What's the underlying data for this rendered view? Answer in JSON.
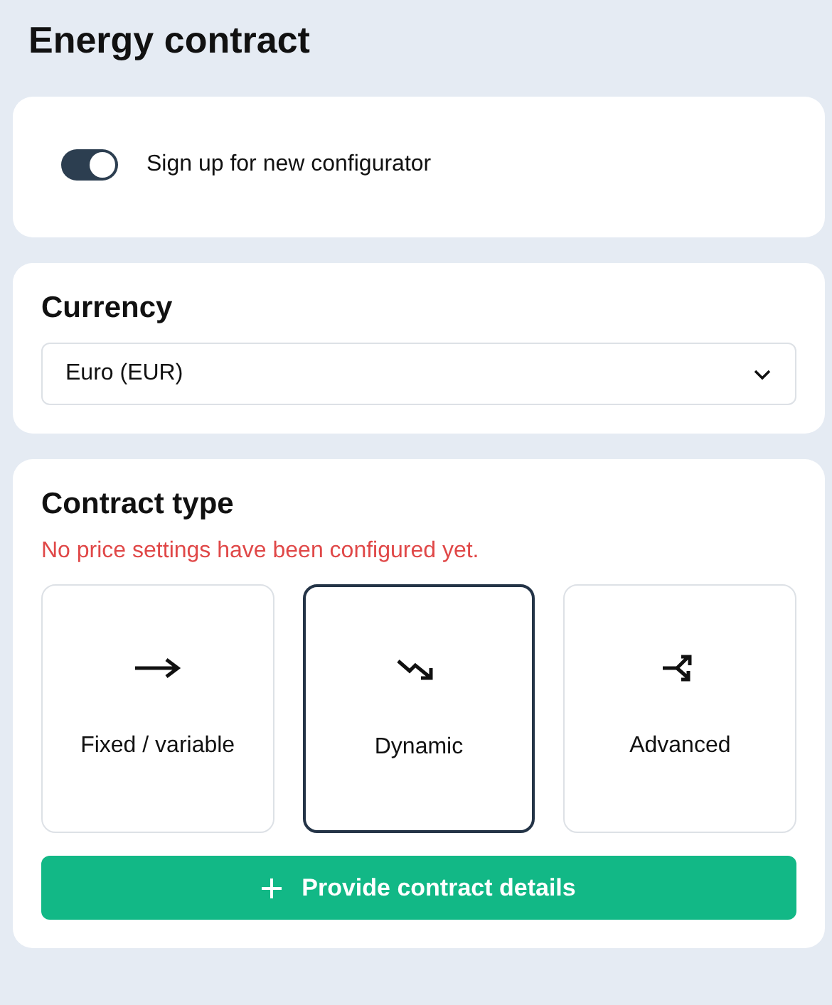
{
  "title": "Energy contract",
  "signup": {
    "label": "Sign up for new configurator",
    "on": true
  },
  "currency": {
    "heading": "Currency",
    "value": "Euro (EUR)"
  },
  "contract_type": {
    "heading": "Contract type",
    "warning": "No price settings have been configured yet.",
    "options": [
      {
        "label": "Fixed / variable",
        "kind": "arrow",
        "selected": false
      },
      {
        "label": "Dynamic",
        "kind": "zigzag",
        "selected": true
      },
      {
        "label": "Advanced",
        "kind": "split",
        "selected": false
      }
    ],
    "button": "Provide contract details"
  }
}
